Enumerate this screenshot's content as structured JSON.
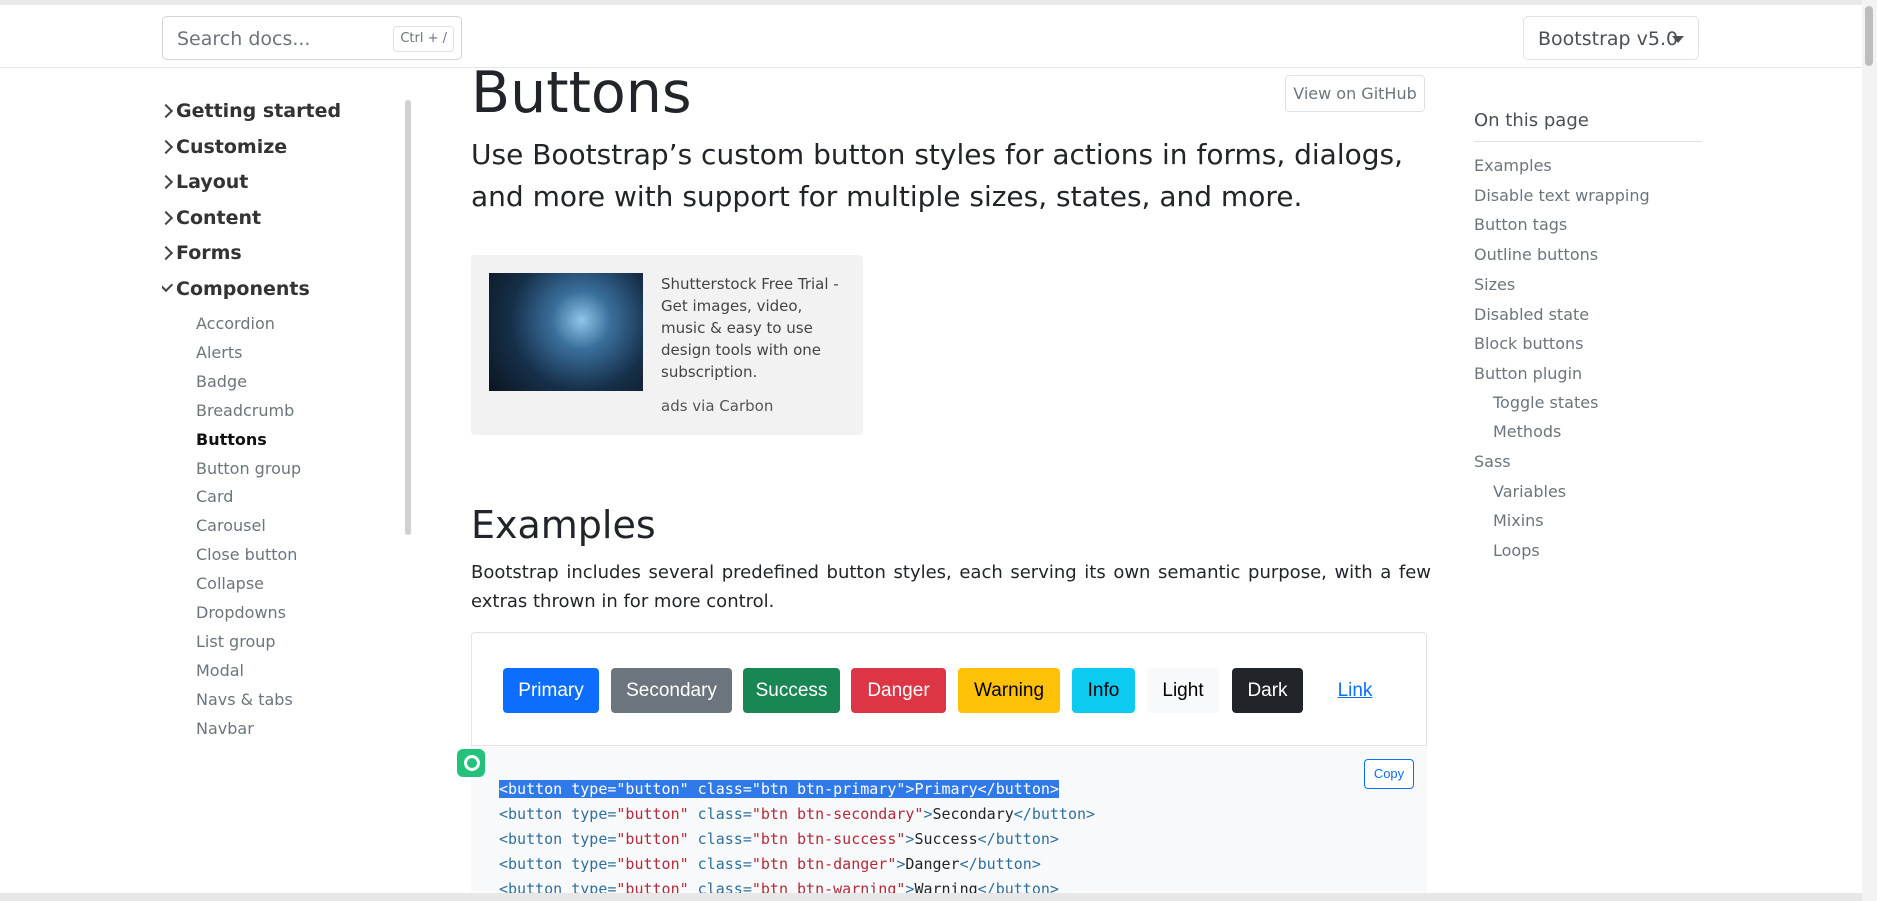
{
  "search": {
    "placeholder": "Search docs...",
    "shortcut": "Ctrl + /"
  },
  "version": {
    "label": "Bootstrap v5.0"
  },
  "sidebar": {
    "categories": [
      {
        "label": "Getting started",
        "expanded": false
      },
      {
        "label": "Customize",
        "expanded": false
      },
      {
        "label": "Layout",
        "expanded": false
      },
      {
        "label": "Content",
        "expanded": false
      },
      {
        "label": "Forms",
        "expanded": false
      },
      {
        "label": "Components",
        "expanded": true
      }
    ],
    "components": [
      "Accordion",
      "Alerts",
      "Badge",
      "Breadcrumb",
      "Buttons",
      "Button group",
      "Card",
      "Carousel",
      "Close button",
      "Collapse",
      "Dropdowns",
      "List group",
      "Modal",
      "Navs & tabs",
      "Navbar"
    ],
    "active": "Buttons"
  },
  "main": {
    "title": "Buttons",
    "github_label": "View on GitHub",
    "lead": "Use Bootstrap’s custom button styles for actions in forms, dialogs, and more with support for multiple sizes, states, and more.",
    "ad": {
      "text": "Shutterstock Free Trial - Get images, video, music & easy to use design tools with one subscription.",
      "via": "ads via Carbon"
    },
    "examples_heading": "Examples",
    "examples_text": "Bootstrap includes several predefined button styles, each serving its own semantic purpose, with a few extras thrown in for more control.",
    "buttons": [
      {
        "label": "Primary",
        "bg": "#0d6efd",
        "fg": "#ffffff"
      },
      {
        "label": "Secondary",
        "bg": "#6c757d",
        "fg": "#ffffff"
      },
      {
        "label": "Success",
        "bg": "#198754",
        "fg": "#ffffff"
      },
      {
        "label": "Danger",
        "bg": "#dc3545",
        "fg": "#ffffff"
      },
      {
        "label": "Warning",
        "bg": "#ffc107",
        "fg": "#000000"
      },
      {
        "label": "Info",
        "bg": "#0dcaf0",
        "fg": "#000000"
      },
      {
        "label": "Light",
        "bg": "#f8f9fa",
        "fg": "#000000"
      },
      {
        "label": "Dark",
        "bg": "#212529",
        "fg": "#ffffff"
      },
      {
        "label": "Link",
        "bg": "transparent",
        "fg": "#0d6efd"
      }
    ],
    "copy_label": "Copy",
    "code_lines": [
      {
        "cls": "btn btn-primary",
        "text": "Primary"
      },
      {
        "cls": "btn btn-secondary",
        "text": "Secondary"
      },
      {
        "cls": "btn btn-success",
        "text": "Success"
      },
      {
        "cls": "btn btn-danger",
        "text": "Danger"
      },
      {
        "cls": "btn btn-warning",
        "text": "Warning"
      }
    ]
  },
  "toc": {
    "title": "On this page",
    "items": [
      {
        "label": "Examples",
        "level": 1
      },
      {
        "label": "Disable text wrapping",
        "level": 1
      },
      {
        "label": "Button tags",
        "level": 1
      },
      {
        "label": "Outline buttons",
        "level": 1
      },
      {
        "label": "Sizes",
        "level": 1
      },
      {
        "label": "Disabled state",
        "level": 1
      },
      {
        "label": "Block buttons",
        "level": 1
      },
      {
        "label": "Button plugin",
        "level": 1
      },
      {
        "label": "Toggle states",
        "level": 2
      },
      {
        "label": "Methods",
        "level": 2
      },
      {
        "label": "Sass",
        "level": 1
      },
      {
        "label": "Variables",
        "level": 2
      },
      {
        "label": "Mixins",
        "level": 2
      },
      {
        "label": "Loops",
        "level": 2
      }
    ]
  },
  "colors": {
    "primary": "#0d6efd",
    "selection": "#2f79e8",
    "extension_icon": "#22c27a"
  },
  "icons": [
    "chevron-right-icon",
    "chevron-down-icon",
    "dropdown-caret-icon",
    "extension-icon"
  ]
}
